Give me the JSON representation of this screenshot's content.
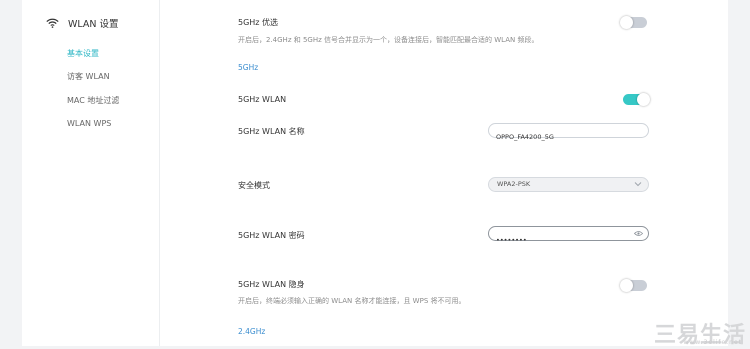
{
  "sidebar": {
    "title": "WLAN 设置",
    "items": [
      {
        "label": "基本设置",
        "active": true
      },
      {
        "label": "访客 WLAN",
        "active": false
      },
      {
        "label": "MAC 地址过滤",
        "active": false
      },
      {
        "label": "WLAN WPS",
        "active": false
      }
    ]
  },
  "main": {
    "band_priority": {
      "label": "5GHz 优选",
      "description": "开启后，2.4GHz 和 5GHz 信号合并显示为一个，设备连接后，智能匹配最合适的 WLAN 频段。",
      "enabled": false
    },
    "section_5g": "5GHz",
    "wlan_5g": {
      "label": "5GHz WLAN",
      "enabled": true
    },
    "wlan_5g_name": {
      "label": "5GHz WLAN 名称",
      "value": "OPPO_FA4200_5G"
    },
    "security_mode": {
      "label": "安全模式",
      "value": "WPA2-PSK"
    },
    "wlan_5g_password": {
      "label": "5GHz WLAN 密码",
      "value": "••••••••"
    },
    "wlan_5g_hidden": {
      "label": "5GHz WLAN 隐身",
      "description": "开启后，终端必须输入正确的 WLAN 名称才能连接，且 WPS 将不可用。",
      "enabled": false
    },
    "section_24g": "2.4GHz"
  },
  "colors": {
    "accent": "#36c8c6",
    "active_nav": "#2cb6c4",
    "section_link": "#3a8dcf",
    "toggle_off": "#c9ced6"
  },
  "watermark": {
    "text": "三易生活",
    "sub": "www.3elife.net"
  }
}
